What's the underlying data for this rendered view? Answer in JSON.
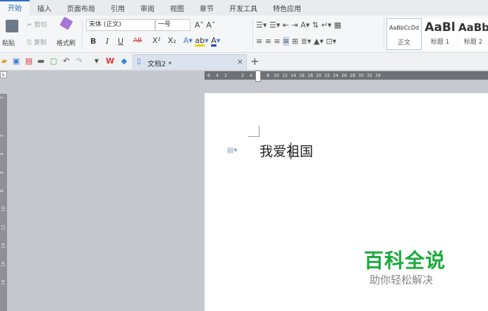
{
  "menu": {
    "tabs": [
      "开始",
      "插入",
      "页面布局",
      "引用",
      "审阅",
      "视图",
      "章节",
      "开发工具",
      "特色应用"
    ]
  },
  "ribbon": {
    "paste": "粘贴",
    "cut": "剪切",
    "copy": "复制",
    "format_painter": "格式刷",
    "font_name": "宋体 (正文)",
    "font_size": "一号",
    "bold": "B",
    "italic": "I",
    "underline": "U",
    "strike": "AB",
    "superscript": "X²",
    "subscript": "X₂",
    "styles": [
      {
        "preview": "AaBbCcDd",
        "label": "正文"
      },
      {
        "preview": "AaBl",
        "label": "标题 1"
      },
      {
        "preview": "AaBb",
        "label": "标题 2"
      }
    ]
  },
  "document_tab": {
    "title": "文档2 *",
    "close": "×",
    "new_tab": "+"
  },
  "hruler": [
    "6",
    "4",
    "2",
    "",
    "2",
    "4",
    "6",
    "8",
    "10",
    "12",
    "14",
    "16",
    "18",
    "20",
    "22",
    "24",
    "26",
    "28",
    "30",
    "32",
    "34"
  ],
  "vruler": [
    "2",
    "2",
    "4",
    "6",
    "8",
    "10",
    "12",
    "14",
    "16",
    "18"
  ],
  "document": {
    "text": "我爱祖国"
  },
  "watermark": {
    "title": "百科全说",
    "subtitle": "助你轻松解决"
  },
  "colors": {
    "accent": "#2b6fc2",
    "watermark_green": "#1aab3a"
  }
}
